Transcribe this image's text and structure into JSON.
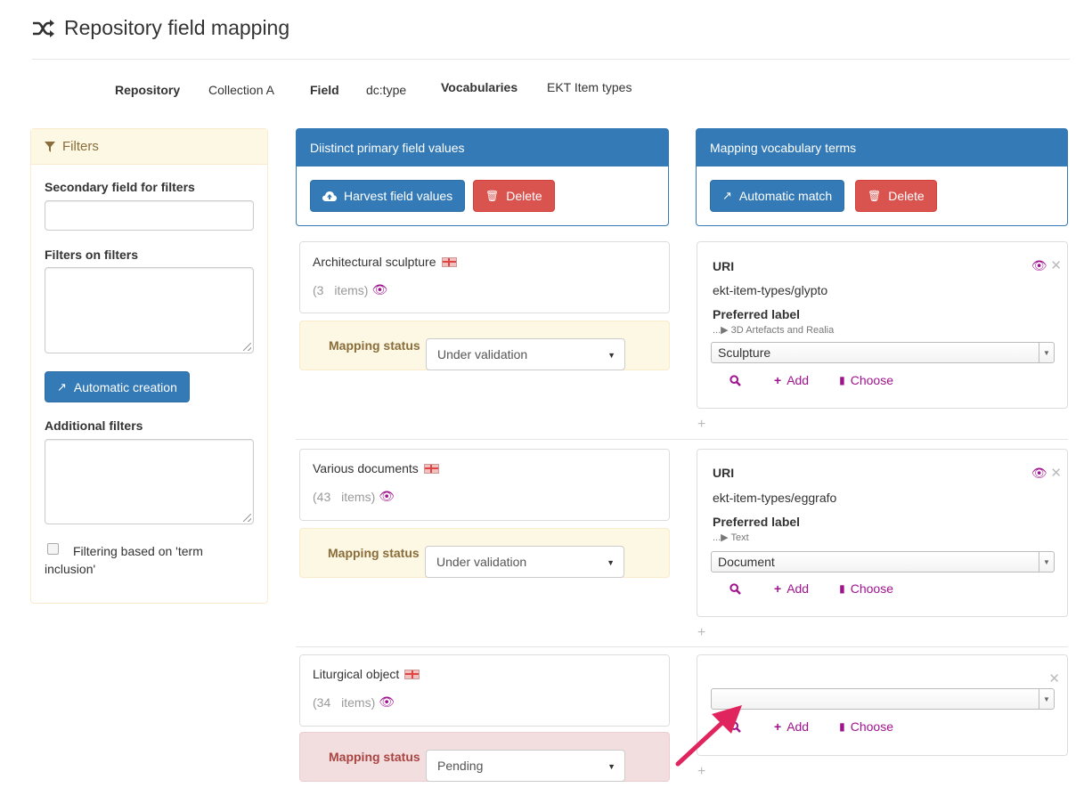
{
  "page": {
    "title": "Repository field mapping",
    "title_icon": "shuffle-icon"
  },
  "meta": {
    "repository_label": "Repository",
    "repository_value": "Collection A",
    "field_label": "Field",
    "field_value": "dc:type",
    "vocabularies_label": "Vocabularies",
    "vocabularies_value": "EKT Item types"
  },
  "filters": {
    "header": "Filters",
    "secondary_label": "Secondary field for filters",
    "secondary_value": "",
    "filters_on_filters_label": "Filters on filters",
    "automatic_creation": "Automatic creation",
    "additional_filters_label": "Additional filters",
    "term_inclusion_label": "Filtering based on 'term inclusion'",
    "term_inclusion_checked": false
  },
  "distinct_panel": {
    "header": "Diistinct primary field values",
    "harvest_button": "Harvest field values",
    "delete_button": "Delete"
  },
  "vocab_panel": {
    "header": "Mapping vocabulary terms",
    "auto_match_button": "Automatic match",
    "delete_button": "Delete"
  },
  "rows": [
    {
      "value": "Architectural sculpture",
      "count_prefix": "(3",
      "count_suffix": "items)",
      "status_label": "Mapping status",
      "status_value": "Under validation",
      "status_type": "warning",
      "term": {
        "uri_label": "URI",
        "uri": "ekt-item-types/glypto",
        "pref_label": "Preferred label",
        "breadcrumb": "...▶ 3D Artefacts and Realia",
        "selected": "Sculpture"
      }
    },
    {
      "value": "Various documents",
      "count_prefix": "(43",
      "count_suffix": "items)",
      "status_label": "Mapping status",
      "status_value": "Under validation",
      "status_type": "warning",
      "term": {
        "uri_label": "URI",
        "uri": "ekt-item-types/eggrafo",
        "pref_label": "Preferred label",
        "breadcrumb": "...▶ Text",
        "selected": "Document"
      }
    },
    {
      "value": "Liturgical object",
      "count_prefix": "(34",
      "count_suffix": "items)",
      "status_label": "Mapping status",
      "status_value": "Pending",
      "status_type": "danger",
      "term": {
        "selected": ""
      }
    }
  ],
  "term_actions": {
    "add": "Add",
    "choose": "Choose"
  },
  "colors": {
    "primary": "#337ab7",
    "danger": "#d9534f",
    "accent": "#a0138e",
    "warning_bg": "#fcf8e3",
    "danger_bg": "#f2dede",
    "arrow": "#e0245e"
  }
}
